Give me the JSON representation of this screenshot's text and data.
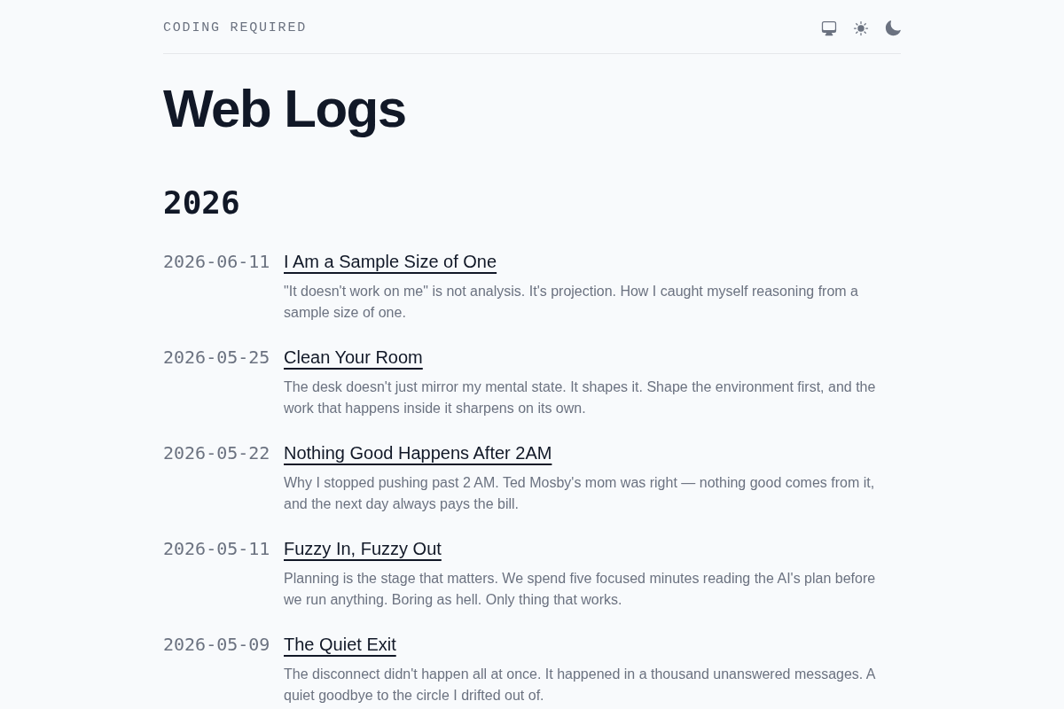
{
  "header": {
    "site_title": "CODING REQUIRED"
  },
  "page_title": "Web Logs",
  "years": [
    {
      "year": "2026",
      "posts": [
        {
          "date": "2026-06-11",
          "title": "I Am a Sample Size of One",
          "summary": "\"It doesn't work on me\" is not analysis. It's projection. How I caught myself reasoning from a sample size of one."
        },
        {
          "date": "2026-05-25",
          "title": "Clean Your Room",
          "summary": "The desk doesn't just mirror my mental state. It shapes it. Shape the environment first, and the work that happens inside it sharpens on its own."
        },
        {
          "date": "2026-05-22",
          "title": "Nothing Good Happens After 2AM",
          "summary": "Why I stopped pushing past 2 AM. Ted Mosby's mom was right — nothing good comes from it, and the next day always pays the bill."
        },
        {
          "date": "2026-05-11",
          "title": "Fuzzy In, Fuzzy Out",
          "summary": "Planning is the stage that matters. We spend five focused minutes reading the AI's plan before we run anything. Boring as hell. Only thing that works."
        },
        {
          "date": "2026-05-09",
          "title": "The Quiet Exit",
          "summary": "The disconnect didn't happen all at once. It happened in a thousand unanswered messages. A quiet goodbye to the circle I drifted out of."
        }
      ]
    }
  ]
}
